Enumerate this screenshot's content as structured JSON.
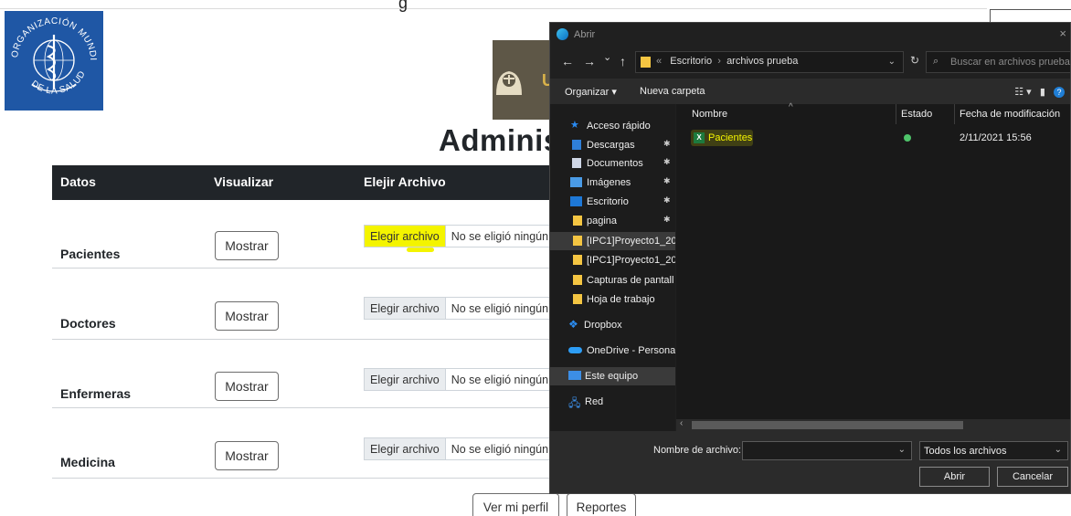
{
  "page": {
    "top_cut_text": "g",
    "title": "Adminis",
    "table": {
      "headers": [
        "Datos",
        "Visualizar",
        "Elejir Archivo"
      ],
      "rows": [
        {
          "label": "Pacientes",
          "view_button": "Mostrar",
          "choose_file": "Elegir archivo",
          "no_file": "No se eligió ningún"
        },
        {
          "label": "Doctores",
          "view_button": "Mostrar",
          "choose_file": "Elegir archivo",
          "no_file": "No se eligió ningún"
        },
        {
          "label": "Enfermeras",
          "view_button": "Mostrar",
          "choose_file": "Elegir archivo",
          "no_file": "No se eligió ningún"
        },
        {
          "label": "Medicina",
          "view_button": "Mostrar",
          "choose_file": "Elegir archivo",
          "no_file": "No se eligió ningún"
        }
      ]
    },
    "footer_buttons": {
      "profile": "Ver mi perfil",
      "reports": "Reportes"
    },
    "logo_text": "U",
    "highlight_color": "#f4f400"
  },
  "dialog": {
    "title": "Abrir",
    "close_glyph": "×",
    "nav": {
      "back": "←",
      "forward": "→",
      "recent": "⌄",
      "up": "↑"
    },
    "address": {
      "prefix": "«",
      "path": [
        "Escritorio",
        "archivos prueba"
      ],
      "separator": "›"
    },
    "search_placeholder": "Buscar en archivos prueba",
    "toolbar": {
      "organize": "Organizar ▾",
      "new_folder": "Nueva carpeta"
    },
    "sidebar": [
      {
        "label": "Acceso rápido",
        "icon": "star-icon",
        "pinned": false
      },
      {
        "label": "Descargas",
        "icon": "download-icon",
        "pinned": true
      },
      {
        "label": "Documentos",
        "icon": "document-icon",
        "pinned": true
      },
      {
        "label": "Imágenes",
        "icon": "image-icon",
        "pinned": true
      },
      {
        "label": "Escritorio",
        "icon": "desktop-icon",
        "pinned": true
      },
      {
        "label": "pagina",
        "icon": "folder-icon",
        "pinned": true
      },
      {
        "label": "[IPC1]Proyecto1_20",
        "icon": "folder-icon",
        "pinned": false
      },
      {
        "label": "[IPC1]Proyecto1_20",
        "icon": "folder-icon",
        "pinned": false
      },
      {
        "label": "Capturas de pantall",
        "icon": "folder-icon",
        "pinned": false
      },
      {
        "label": "Hoja de trabajo",
        "icon": "folder-icon",
        "pinned": false
      },
      {
        "label": "Dropbox",
        "icon": "dropbox-icon",
        "pinned": false
      },
      {
        "label": "OneDrive - Personal",
        "icon": "cloud-icon",
        "pinned": false
      },
      {
        "label": "Este equipo",
        "icon": "computer-icon",
        "pinned": false
      },
      {
        "label": "Red",
        "icon": "network-icon",
        "pinned": false
      }
    ],
    "columns": [
      "Nombre",
      "Estado",
      "Fecha de modificación"
    ],
    "files": [
      {
        "name": "Pacientes",
        "icon": "excel-file-icon",
        "status": "synced",
        "modified": "2/11/2021 15:56"
      }
    ],
    "file_name_label": "Nombre de archivo:",
    "file_name_value": "",
    "filter": "Todos los archivos",
    "open_button": "Abrir",
    "cancel_button": "Cancelar"
  }
}
